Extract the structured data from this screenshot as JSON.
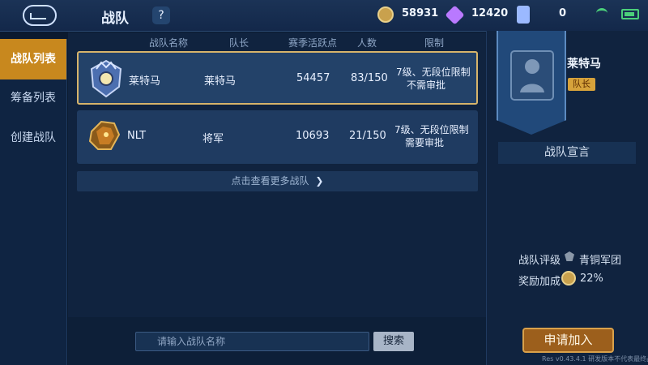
{
  "header": {
    "title": "战队",
    "help_label": "?",
    "gold_value": "58931",
    "gem_value": "12420",
    "card_value": "0"
  },
  "sidebar": {
    "items": [
      {
        "label": "战队列表"
      },
      {
        "label": "筹备列表"
      },
      {
        "label": "创建战队"
      }
    ]
  },
  "table": {
    "headers": [
      "战队名称",
      "队长",
      "赛季活跃点",
      "人数",
      "限制"
    ],
    "rows": [
      {
        "name": "莱特马",
        "captain": "莱特马",
        "activity": "54457",
        "members": "83/150",
        "limit_line1": "7级、无段位限制",
        "limit_line2": "不需审批"
      },
      {
        "name": "NLT",
        "captain": "将军",
        "activity": "10693",
        "members": "21/150",
        "limit_line1": "7级、无段位限制",
        "limit_line2": "需要审批"
      }
    ],
    "more_label": "点击查看更多战队"
  },
  "search": {
    "placeholder": "请输入战队名称",
    "button_label": "搜索"
  },
  "detail": {
    "captain_name": "莱特马",
    "captain_badge": "队长",
    "declaration_title": "战队宣言",
    "rating_label": "战队评级",
    "rating_value": "青铜军团",
    "bonus_label": "奖励加成",
    "bonus_value": "22%",
    "apply_label": "申请加入",
    "version_text": "Res v0.43.4.1 研发版本不代表最终品质"
  },
  "colors": {
    "accent": "#c8881e",
    "background": "#0b1a2f",
    "status_ok": "#4bd07a"
  },
  "icons": [
    "back-icon",
    "help-icon",
    "coin-icon",
    "gem-icon",
    "card-icon",
    "wifi-icon",
    "battery-icon",
    "search-icon",
    "chevron-right-icon"
  ]
}
